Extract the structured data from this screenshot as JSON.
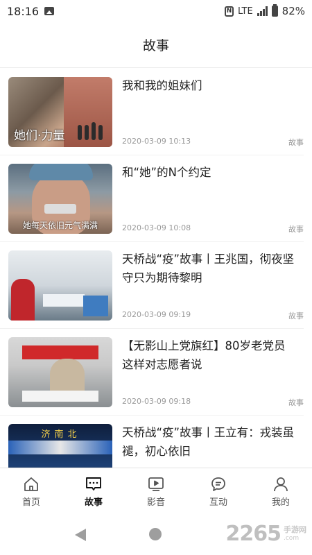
{
  "status": {
    "time": "18:16",
    "network": "LTE",
    "battery": "82%"
  },
  "header": {
    "title": "故事"
  },
  "news": [
    {
      "title": "我和我的姐妹们",
      "date": "2020-03-09 10:13",
      "tag": "故事",
      "thumb_caption": "她们·力量"
    },
    {
      "title": "和“她”的N个约定",
      "date": "2020-03-09 10:08",
      "tag": "故事",
      "thumb_caption": "她每天依旧元气满满"
    },
    {
      "title": "天桥战“疫”故事丨王兆国，彻夜坚守只为期待黎明",
      "date": "2020-03-09 09:19",
      "tag": "故事"
    },
    {
      "title": "【无影山上党旗红】80岁老党员这样对志愿者说",
      "date": "2020-03-09 09:18",
      "tag": "故事"
    },
    {
      "title": "天桥战“疫”故事丨王立有：戎装虽褪，初心依旧",
      "thumb_caption": "济南北"
    }
  ],
  "bottom_nav": [
    {
      "label": "首页",
      "icon": "home-icon",
      "active": false
    },
    {
      "label": "故事",
      "icon": "chat-dots-icon",
      "active": true
    },
    {
      "label": "影音",
      "icon": "play-icon",
      "active": false
    },
    {
      "label": "互动",
      "icon": "comment-icon",
      "active": false
    },
    {
      "label": "我的",
      "icon": "user-icon",
      "active": false
    }
  ],
  "watermark": {
    "number": "2265",
    "site": "手游网",
    "domain": ".com"
  }
}
